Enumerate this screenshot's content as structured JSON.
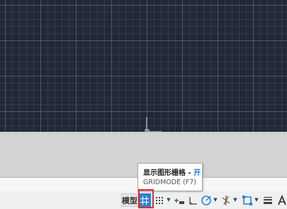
{
  "tooltip": {
    "title": "显示图形栅格 - ",
    "state": "开",
    "shortcut": "GRIDMODE (F7)"
  },
  "statusbar": {
    "model_label": "模型"
  },
  "colors": {
    "canvas_bg": "#212836",
    "accent": "#2a84d6",
    "highlight": "#e02b2b",
    "tooltip_on": "#1a75d2"
  },
  "icons": [
    "ucs-crosshair-icon",
    "grid-icon",
    "snap-icon",
    "chevron-down-icon",
    "infer-constraints-icon",
    "ortho-icon",
    "polar-tracking-icon",
    "isodraft-icon",
    "object-snap-icon",
    "lineweight-icon",
    "annotation-icon"
  ]
}
